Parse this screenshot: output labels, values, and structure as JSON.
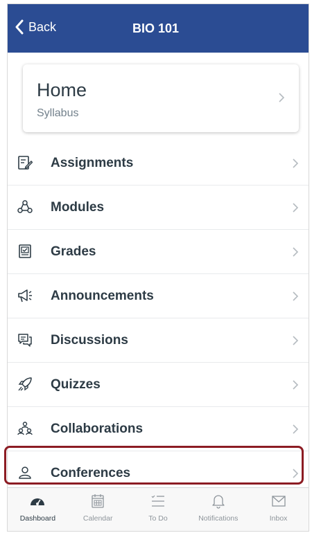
{
  "nav": {
    "back_label": "Back",
    "title": "BIO 101",
    "bar_color": "#2b4c93"
  },
  "home": {
    "title": "Home",
    "subtitle": "Syllabus"
  },
  "menu": {
    "items": [
      {
        "label": "Assignments",
        "icon": "assignments-icon"
      },
      {
        "label": "Modules",
        "icon": "modules-icon"
      },
      {
        "label": "Grades",
        "icon": "grades-icon"
      },
      {
        "label": "Announcements",
        "icon": "announcements-icon"
      },
      {
        "label": "Discussions",
        "icon": "discussions-icon"
      },
      {
        "label": "Quizzes",
        "icon": "quizzes-icon"
      },
      {
        "label": "Collaborations",
        "icon": "collaborations-icon"
      },
      {
        "label": "Conferences",
        "icon": "conferences-icon",
        "highlighted": true
      }
    ],
    "highlight_color": "#8c1c23"
  },
  "tabbar": {
    "tabs": [
      {
        "label": "Dashboard",
        "icon": "dashboard-icon",
        "active": true
      },
      {
        "label": "Calendar",
        "icon": "calendar-icon"
      },
      {
        "label": "To Do",
        "icon": "todo-icon"
      },
      {
        "label": "Notifications",
        "icon": "notifications-icon"
      },
      {
        "label": "Inbox",
        "icon": "inbox-icon"
      }
    ]
  }
}
